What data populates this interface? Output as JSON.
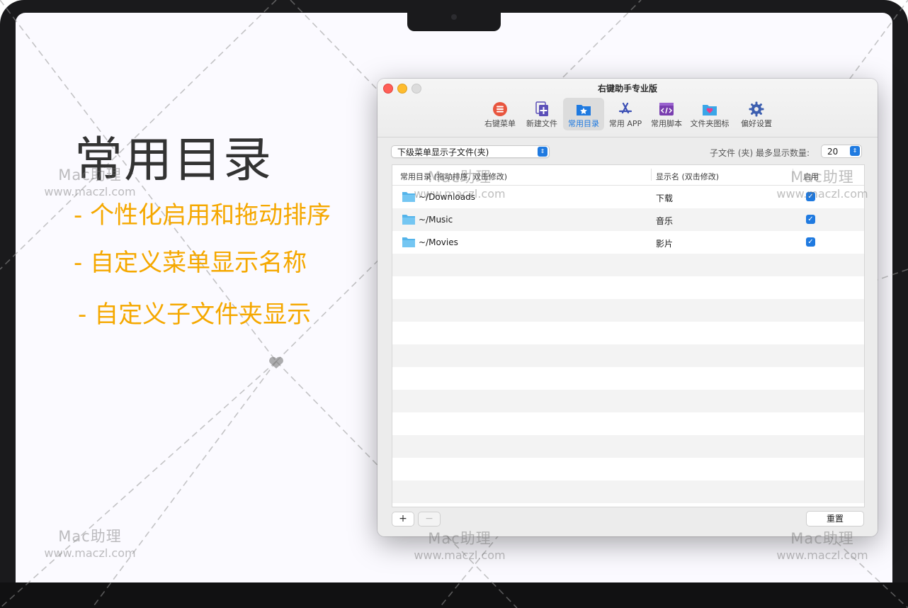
{
  "promo": {
    "title": "常用目录",
    "features": [
      "- 个性化启用和拖动排序",
      "- 自定义菜单显示名称",
      "- 自定义子文件夹显示"
    ]
  },
  "watermark": {
    "brand": "Mac助理",
    "site": "www.maczl.com"
  },
  "window": {
    "title": "右键助手专业版",
    "toolbar": [
      {
        "label": "右键菜单",
        "icon": "list-icon",
        "color": "#e8553e"
      },
      {
        "label": "新建文件",
        "icon": "new-file-icon",
        "color": "#5b4fb8"
      },
      {
        "label": "常用目录",
        "icon": "folder-star-icon",
        "color": "#1f7ae0",
        "active": true
      },
      {
        "label": "常用 APP",
        "icon": "app-store-icon",
        "color": "#3b4fb5"
      },
      {
        "label": "常用脚本",
        "icon": "script-icon",
        "color": "#7a3fb0"
      },
      {
        "label": "文件夹图标",
        "icon": "folder-heart-icon",
        "color": "#3aa6e8"
      },
      {
        "label": "偏好设置",
        "icon": "gear-icon",
        "color": "#3d5fb0"
      }
    ],
    "submenu_select": "下级菜单显示子文件(夹)",
    "max_count_label": "子文件 (夹) 最多显示数量:",
    "max_count_value": "20",
    "table": {
      "headers": [
        "常用目录 (拖动排序, 双击修改)",
        "显示名 (双击修改)",
        "启用"
      ],
      "rows": [
        {
          "path": "~/Downloads",
          "name": "下载",
          "enabled": true
        },
        {
          "path": "~/Music",
          "name": "音乐",
          "enabled": true
        },
        {
          "path": "~/Movies",
          "name": "影片",
          "enabled": true
        }
      ]
    },
    "add_label": "+",
    "remove_label": "−",
    "reset_label": "重置"
  }
}
